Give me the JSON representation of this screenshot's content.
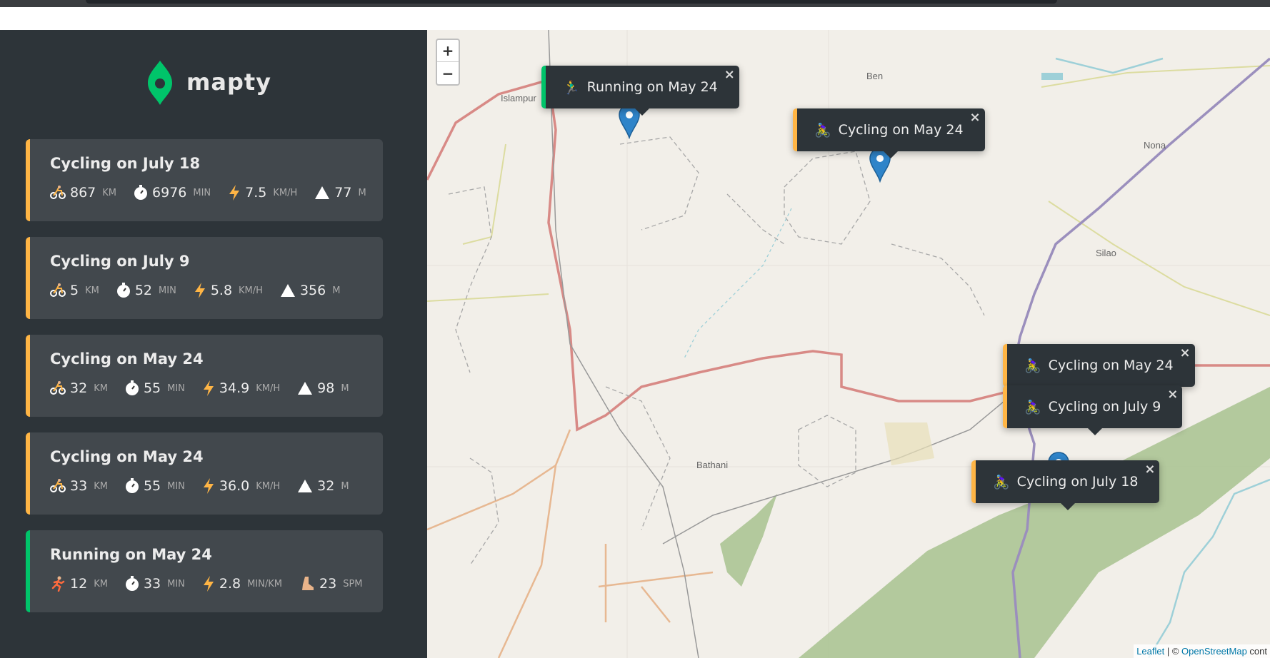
{
  "app": {
    "name": "mapty",
    "accent_cycling": "#ffb545",
    "accent_running": "#00c46a"
  },
  "workouts": [
    {
      "type": "cycling",
      "title": "Cycling on July 18",
      "distance": "867",
      "distance_unit": "km",
      "duration": "6976",
      "duration_unit": "min",
      "speed": "7.5",
      "speed_unit": "km/h",
      "elev": "77",
      "elev_unit": "m"
    },
    {
      "type": "cycling",
      "title": "Cycling on July 9",
      "distance": "5",
      "distance_unit": "km",
      "duration": "52",
      "duration_unit": "min",
      "speed": "5.8",
      "speed_unit": "km/h",
      "elev": "356",
      "elev_unit": "m"
    },
    {
      "type": "cycling",
      "title": "Cycling on May 24",
      "distance": "32",
      "distance_unit": "km",
      "duration": "55",
      "duration_unit": "min",
      "speed": "34.9",
      "speed_unit": "km/h",
      "elev": "98",
      "elev_unit": "m"
    },
    {
      "type": "cycling",
      "title": "Cycling on May 24",
      "distance": "33",
      "distance_unit": "km",
      "duration": "55",
      "duration_unit": "min",
      "speed": "36.0",
      "speed_unit": "km/h",
      "elev": "32",
      "elev_unit": "m"
    },
    {
      "type": "running",
      "title": "Running on May 24",
      "distance": "12",
      "distance_unit": "km",
      "duration": "33",
      "duration_unit": "min",
      "speed": "2.8",
      "speed_unit": "min/km",
      "elev": "23",
      "elev_unit": "spm"
    }
  ],
  "map": {
    "zoom_in": "+",
    "zoom_out": "−",
    "places": [
      "Islampur",
      "Ben",
      "Nona",
      "Silao",
      "Bathani"
    ],
    "popups": [
      {
        "type": "running",
        "emoji": "🏃‍♂️",
        "label": "Running on May 24",
        "close": "×"
      },
      {
        "type": "cycling",
        "emoji": "🚴‍♀️",
        "label": "Cycling on May 24",
        "close": "×"
      },
      {
        "type": "cycling",
        "emoji": "🚴‍♀️",
        "label": "Cycling on May 24",
        "close": "×"
      },
      {
        "type": "cycling",
        "emoji": "🚴‍♀️",
        "label": "Cycling on July 9",
        "close": "×"
      },
      {
        "type": "cycling",
        "emoji": "🚴‍♀️",
        "label": "Cycling on July 18",
        "close": "×"
      }
    ],
    "attribution": {
      "leaflet": "Leaflet",
      "sep": " | © ",
      "osm": "OpenStreetMap",
      "tail": " cont"
    }
  }
}
